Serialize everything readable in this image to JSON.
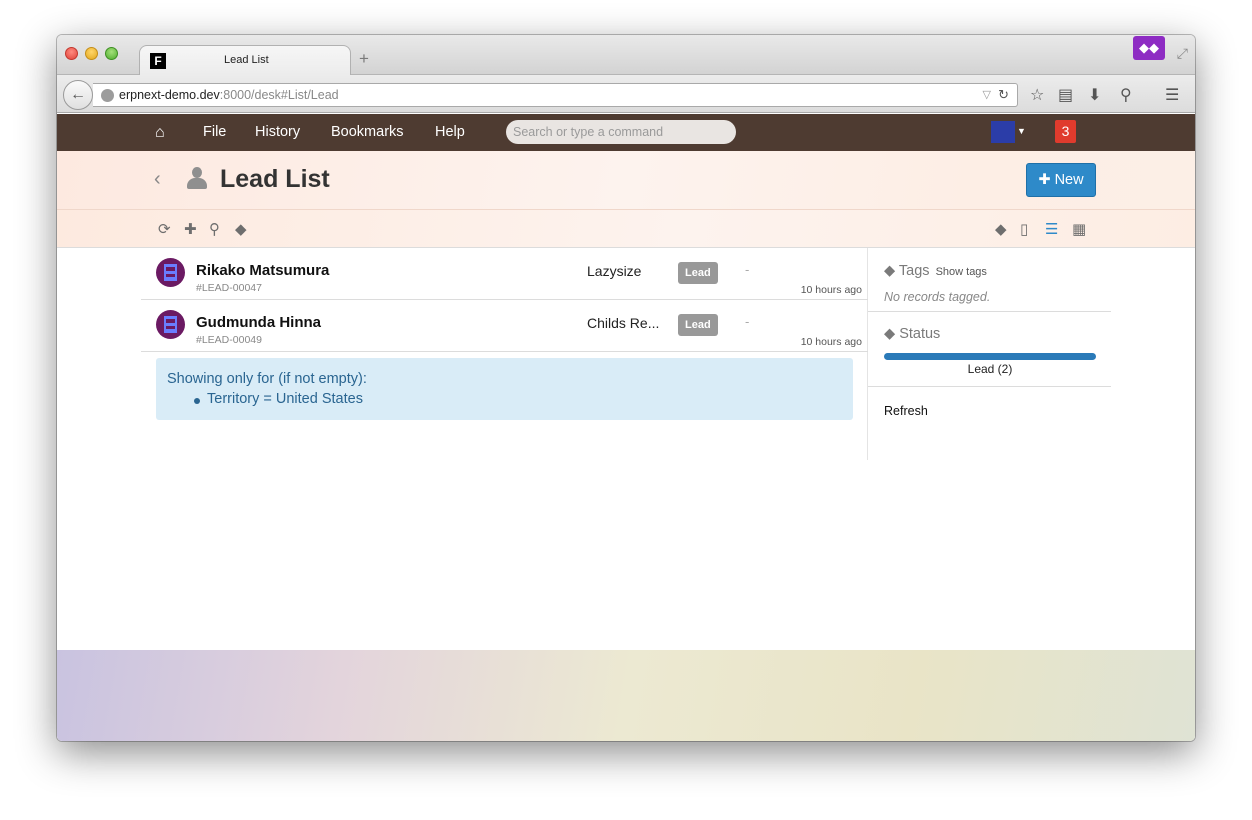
{
  "browser": {
    "tab_title": "Lead List",
    "tab_favicon": "F",
    "url_host": "erpnext-demo.dev",
    "url_rest": ":8000/desk#List/Lead",
    "colors": {
      "mask_button": "#8e2cc3"
    }
  },
  "appbar": {
    "menu": [
      "File",
      "History",
      "Bookmarks",
      "Help"
    ],
    "search_placeholder": "Search or type a command",
    "notification_count": "3",
    "colors": {
      "bar": "#4e3b31",
      "badge": "#e03b2d"
    }
  },
  "page": {
    "title": "Lead List",
    "new_button": "New",
    "colors": {
      "primary": "#2e8ac9"
    }
  },
  "list": {
    "rows": [
      {
        "name": "Rikako Matsumura",
        "id": "#LEAD-00047",
        "company": "Lazysize",
        "status": "Lead",
        "extra": "-",
        "time": "10 hours ago"
      },
      {
        "name": "Gudmunda Hinna",
        "id": "#LEAD-00049",
        "company": "Childs Re...",
        "status": "Lead",
        "extra": "-",
        "time": "10 hours ago"
      }
    ],
    "filter": {
      "heading": "Showing only for (if not empty):",
      "items": [
        "Territory = United States"
      ]
    }
  },
  "sidebar": {
    "tags_title": "Tags",
    "tags_link": "Show tags",
    "tags_empty": "No records tagged.",
    "status_title": "Status",
    "status_item": "Lead (2)",
    "refresh": "Refresh"
  }
}
